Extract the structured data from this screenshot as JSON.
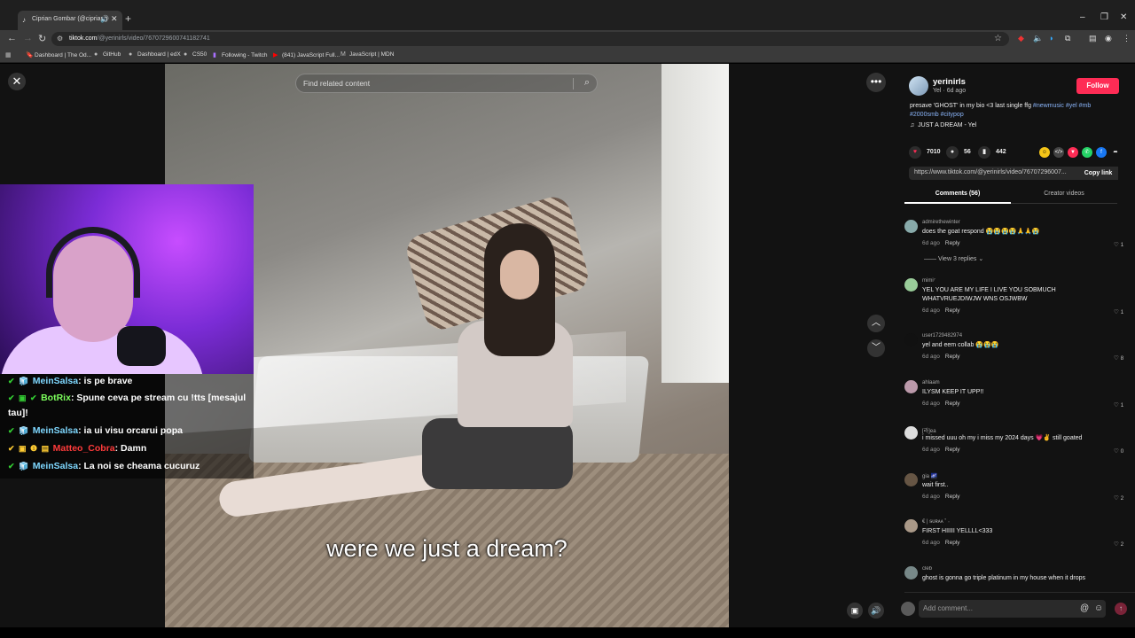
{
  "browser": {
    "tab_title": "Ciprian Gombar (@cipriang",
    "url_host": "tiktok.com",
    "url_path": "/@yerinirls/video/7670729600741182741",
    "bookmarks": [
      "Dashboard | The Od...",
      "GitHub",
      "Dashboard | edX",
      "CS50",
      "Following - Twitch",
      "(841) JavaScript Full...",
      "JavaScript | MDN"
    ]
  },
  "player": {
    "search_placeholder": "Find related content",
    "caption": "were we just a dream?"
  },
  "stream": {
    "chat": [
      {
        "user": "MeinSalsa",
        "user_color": "#7fd8ff",
        "text": ": is pe brave"
      },
      {
        "user": "BotRix",
        "user_color": "#7cff5c",
        "text": ": Spune ceva pe stream cu !tts [mesajul"
      },
      {
        "user": "",
        "user_color": "#ffffff",
        "text": "tau]!"
      },
      {
        "user": "MeinSalsa",
        "user_color": "#7fd8ff",
        "text": ": ia ui visu orcarui popa"
      },
      {
        "user": "Matteo_Cobra",
        "user_color": "#ff3b3b",
        "text": ": Damn"
      },
      {
        "user": "MeinSalsa",
        "user_color": "#7fd8ff",
        "text": ": La noi se cheama cucuruz"
      }
    ]
  },
  "post": {
    "username": "yerinirls",
    "subtitle": "Yel · 6d ago",
    "follow_label": "Follow",
    "desc_text": "presave 'GHOST' in my bio <3 last single ffg",
    "desc_tags_1": "#newmusic #yel #mb",
    "desc_tags_2": "#2000smb #citypop",
    "music": "JUST A DREAM - Yel",
    "likes": "7010",
    "comments_count": "56",
    "saves": "442",
    "link": "https://www.tiktok.com/@yerinirls/video/76707296007...",
    "copy_label": "Copy link",
    "tab_comments": "Comments (56)",
    "tab_creator": "Creator videos"
  },
  "comments": [
    {
      "user": "admirethewinter",
      "text": "does the goat respond 😭😭😭😭🙏🙏😭",
      "age": "6d ago",
      "reply": "Reply",
      "likes": "1",
      "avatar": "#8aa"
    },
    {
      "user": "mimi⁷",
      "text": "YEL YOU ARE MY LIFE I LIVE YOU SOBMUCH WHATVRUEJDIWJW WNS OSJWBW",
      "age": "6d ago",
      "reply": "Reply",
      "likes": "1",
      "avatar": "#9c9"
    },
    {
      "user": "user1729482974",
      "text": "yel and eem collab 😭😭😭",
      "age": "6d ago",
      "reply": "Reply",
      "likes": "8",
      "avatar": "#111"
    },
    {
      "user": "ahlaam",
      "text": "ILYSM KEEP IT UPP!!",
      "age": "6d ago",
      "reply": "Reply",
      "likes": "1",
      "avatar": "#b9a"
    },
    {
      "user": "[라]ea",
      "text": "i missed uuu oh my i miss my 2024 days 💗✌ still goated",
      "age": "6d ago",
      "reply": "Reply",
      "likes": "0",
      "avatar": "#ddd"
    },
    {
      "user": "gia 🌌",
      "text": "wait first..",
      "age": "6d ago",
      "reply": "Reply",
      "likes": "2",
      "avatar": "#654"
    },
    {
      "user": "€ | ᵴᴜʀᴀᴀ ˚ ˖",
      "text": "FIRST HIIIII YELLLL<333",
      "age": "6d ago",
      "reply": "Reply",
      "likes": "2",
      "avatar": "#a98"
    },
    {
      "user": "cleb",
      "text": "ghost is gonna go triple platinum in my house when it drops",
      "age": "",
      "reply": "",
      "likes": "",
      "avatar": "#788"
    }
  ],
  "view_replies": "View 3 replies",
  "comment_placeholder": "Add comment..."
}
